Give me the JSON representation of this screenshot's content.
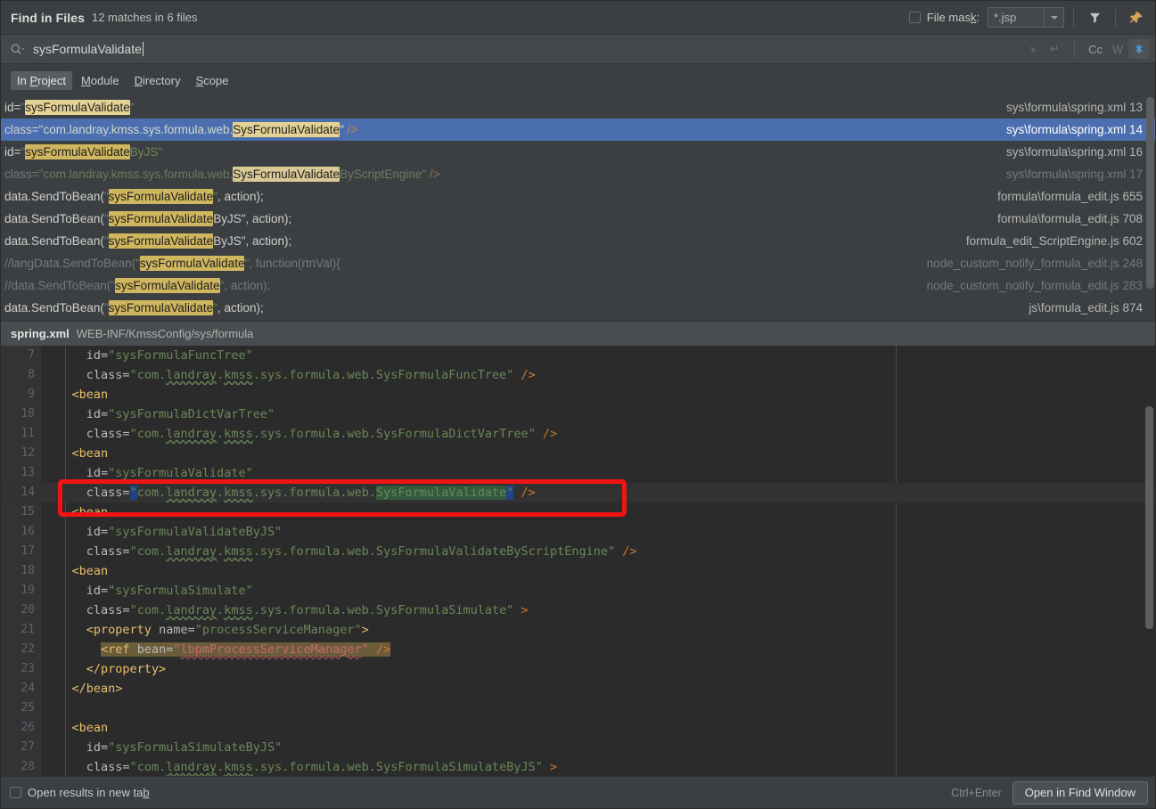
{
  "window": {
    "title": "Find in Files",
    "subtitle": "12 matches in 6 files"
  },
  "toolbar": {
    "file_mask_label_pre": "File mas",
    "file_mask_label_mnemonic": "k",
    "file_mask_label_post": ":",
    "file_mask_value": "*.jsp",
    "filter_icon": "filter-icon",
    "pin_icon": "pin-icon"
  },
  "search": {
    "value": "sysFormulaValidate",
    "icon": "search-icon",
    "clear_label": "×",
    "newline_label": "↵",
    "match_case_label": "Cc",
    "words_label": "W",
    "regex_label": "✻"
  },
  "scope": {
    "items": [
      {
        "pre": "In ",
        "mnemonic": "P",
        "post": "roject",
        "active": true
      },
      {
        "pre": "",
        "mnemonic": "M",
        "post": "odule",
        "active": false
      },
      {
        "pre": "",
        "mnemonic": "D",
        "post": "irectory",
        "active": false
      },
      {
        "pre": "",
        "mnemonic": "S",
        "post": "cope",
        "active": false
      }
    ]
  },
  "results": {
    "rows": [
      {
        "selected": false,
        "dim": false,
        "parts": [
          {
            "t": "id=",
            "c": "plain"
          },
          {
            "t": "\"",
            "c": "str"
          },
          {
            "t": "sysFormulaValidate",
            "c": "hl"
          },
          {
            "t": "\"",
            "c": "str"
          }
        ],
        "path": "sys\\formula\\spring.xml 13"
      },
      {
        "selected": true,
        "dim": false,
        "parts": [
          {
            "t": "class=",
            "c": "plain"
          },
          {
            "t": "\"com.landray.kmss.sys.formula.web.",
            "c": "str"
          },
          {
            "t": "SysFormulaValidate",
            "c": "hl"
          },
          {
            "t": "\"",
            "c": "str"
          },
          {
            "t": " ",
            "c": "plain"
          },
          {
            "t": "/>",
            "c": "punct"
          }
        ],
        "path": "sys\\formula\\spring.xml 14"
      },
      {
        "selected": false,
        "dim": false,
        "parts": [
          {
            "t": "id=",
            "c": "plain"
          },
          {
            "t": "\"",
            "c": "str"
          },
          {
            "t": "sysFormulaValidate",
            "c": "hl2"
          },
          {
            "t": "ByJS\"",
            "c": "str"
          }
        ],
        "path": "sys\\formula\\spring.xml 16"
      },
      {
        "selected": false,
        "dim": true,
        "parts": [
          {
            "t": "class=",
            "c": "plain"
          },
          {
            "t": "\"com.landray.kmss.sys.formula.web.",
            "c": "str"
          },
          {
            "t": "SysFormulaValidate",
            "c": "hl"
          },
          {
            "t": "ByScriptEngine\"",
            "c": "str"
          },
          {
            "t": " ",
            "c": "plain"
          },
          {
            "t": "/>",
            "c": "punct"
          }
        ],
        "path": "sys\\formula\\spring.xml 17"
      },
      {
        "selected": false,
        "dim": false,
        "parts": [
          {
            "t": "data.SendToBean(",
            "c": "plain"
          },
          {
            "t": "\"",
            "c": "str"
          },
          {
            "t": "sysFormulaValidate",
            "c": "hl2"
          },
          {
            "t": "\"",
            "c": "str"
          },
          {
            "t": ", action);",
            "c": "plain"
          }
        ],
        "path": "formula\\formula_edit.js 655"
      },
      {
        "selected": false,
        "dim": false,
        "parts": [
          {
            "t": "data.SendToBean(",
            "c": "plain"
          },
          {
            "t": "\"",
            "c": "str"
          },
          {
            "t": "sysFormulaValidate",
            "c": "hl2"
          },
          {
            "t": "ByJS\", action);",
            "c": "plain"
          }
        ],
        "path": "formula\\formula_edit.js 708"
      },
      {
        "selected": false,
        "dim": false,
        "parts": [
          {
            "t": "data.SendToBean(",
            "c": "plain"
          },
          {
            "t": "\"",
            "c": "str"
          },
          {
            "t": "sysFormulaValidate",
            "c": "hl2"
          },
          {
            "t": "ByJS\", action);",
            "c": "plain"
          }
        ],
        "path": "formula_edit_ScriptEngine.js 602"
      },
      {
        "selected": false,
        "dim": true,
        "parts": [
          {
            "t": "//langData.SendToBean(",
            "c": "plain"
          },
          {
            "t": "\"",
            "c": "str"
          },
          {
            "t": "sysFormulaValidate",
            "c": "hl2"
          },
          {
            "t": "\"",
            "c": "str"
          },
          {
            "t": ", function(rtnVal){",
            "c": "plain"
          }
        ],
        "path": "node_custom_notify_formula_edit.js 248"
      },
      {
        "selected": false,
        "dim": true,
        "parts": [
          {
            "t": "//data.SendToBean(",
            "c": "plain"
          },
          {
            "t": "\"",
            "c": "str"
          },
          {
            "t": "sysFormulaValidate",
            "c": "hl2"
          },
          {
            "t": "\"",
            "c": "str"
          },
          {
            "t": ", action);",
            "c": "plain"
          }
        ],
        "path": "node_custom_notify_formula_edit.js 283"
      },
      {
        "selected": false,
        "dim": false,
        "parts": [
          {
            "t": "data.SendToBean(",
            "c": "plain"
          },
          {
            "t": "\"",
            "c": "str"
          },
          {
            "t": "sysFormulaValidate",
            "c": "hl2"
          },
          {
            "t": "\"",
            "c": "str"
          },
          {
            "t": ", action);",
            "c": "plain"
          }
        ],
        "path": "js\\formula_edit.js 874"
      }
    ]
  },
  "file_header": {
    "name": "spring.xml",
    "path": "WEB-INF/KmssConfig/sys/formula"
  },
  "code": {
    "lines": [
      {
        "n": "7",
        "indent": 6,
        "cur": false,
        "parts": [
          {
            "t": "id=",
            "c": "attrname"
          },
          {
            "t": "\"sysFormulaFuncTree\"",
            "c": "str"
          }
        ]
      },
      {
        "n": "8",
        "indent": 6,
        "cur": false,
        "parts": [
          {
            "t": "class=",
            "c": "attrname"
          },
          {
            "t": "\"com.",
            "c": "str"
          },
          {
            "t": "landray",
            "c": "str-wavy"
          },
          {
            "t": ".",
            "c": "str"
          },
          {
            "t": "kmss",
            "c": "str-wavy"
          },
          {
            "t": ".sys.formula.web.SysFormulaFuncTree\"",
            "c": "str"
          },
          {
            "t": " ",
            "c": "plain"
          },
          {
            "t": "/>",
            "c": "punct"
          }
        ]
      },
      {
        "n": "9",
        "indent": 4,
        "cur": false,
        "parts": [
          {
            "t": "<bean",
            "c": "tag"
          }
        ]
      },
      {
        "n": "10",
        "indent": 6,
        "cur": false,
        "parts": [
          {
            "t": "id=",
            "c": "attrname"
          },
          {
            "t": "\"sysFormulaDictVarTree\"",
            "c": "str"
          }
        ]
      },
      {
        "n": "11",
        "indent": 6,
        "cur": false,
        "parts": [
          {
            "t": "class=",
            "c": "attrname"
          },
          {
            "t": "\"com.",
            "c": "str"
          },
          {
            "t": "landray",
            "c": "str-wavy"
          },
          {
            "t": ".",
            "c": "str"
          },
          {
            "t": "kmss",
            "c": "str-wavy"
          },
          {
            "t": ".sys.formula.web.SysFormulaDictVarTree\"",
            "c": "str"
          },
          {
            "t": " ",
            "c": "plain"
          },
          {
            "t": "/>",
            "c": "punct"
          }
        ]
      },
      {
        "n": "12",
        "indent": 4,
        "cur": false,
        "parts": [
          {
            "t": "<bean",
            "c": "tag"
          }
        ]
      },
      {
        "n": "13",
        "indent": 6,
        "cur": false,
        "parts": [
          {
            "t": "id=",
            "c": "attrname"
          },
          {
            "t": "\"sysFormulaValidate\"",
            "c": "str"
          }
        ]
      },
      {
        "n": "14",
        "indent": 6,
        "cur": true,
        "parts": [
          {
            "t": "class=",
            "c": "attrname"
          },
          {
            "t": "\"",
            "c": "str-sel"
          },
          {
            "t": "com.",
            "c": "str"
          },
          {
            "t": "landray",
            "c": "str-wavy"
          },
          {
            "t": ".",
            "c": "str"
          },
          {
            "t": "kmss",
            "c": "str-wavy"
          },
          {
            "t": ".sys.formula.web.",
            "c": "str"
          },
          {
            "t": "SysFormulaValidate",
            "c": "str-match"
          },
          {
            "t": "\"",
            "c": "str-sel"
          },
          {
            "t": " ",
            "c": "plain"
          },
          {
            "t": "/>",
            "c": "punct"
          }
        ]
      },
      {
        "n": "15",
        "indent": 4,
        "cur": false,
        "parts": [
          {
            "t": "<bean",
            "c": "tag"
          }
        ]
      },
      {
        "n": "16",
        "indent": 6,
        "cur": false,
        "parts": [
          {
            "t": "id=",
            "c": "attrname"
          },
          {
            "t": "\"sysFormulaValidateByJS\"",
            "c": "str"
          }
        ]
      },
      {
        "n": "17",
        "indent": 6,
        "cur": false,
        "parts": [
          {
            "t": "class=",
            "c": "attrname"
          },
          {
            "t": "\"com.",
            "c": "str"
          },
          {
            "t": "landray",
            "c": "str-wavy"
          },
          {
            "t": ".",
            "c": "str"
          },
          {
            "t": "kmss",
            "c": "str-wavy"
          },
          {
            "t": ".sys.formula.web.SysFormulaValidateByScriptEngine\"",
            "c": "str"
          },
          {
            "t": " ",
            "c": "plain"
          },
          {
            "t": "/>",
            "c": "punct"
          }
        ]
      },
      {
        "n": "18",
        "indent": 4,
        "cur": false,
        "parts": [
          {
            "t": "<bean",
            "c": "tag"
          }
        ]
      },
      {
        "n": "19",
        "indent": 6,
        "cur": false,
        "parts": [
          {
            "t": "id=",
            "c": "attrname"
          },
          {
            "t": "\"sysFormulaSimulate\"",
            "c": "str"
          }
        ]
      },
      {
        "n": "20",
        "indent": 6,
        "cur": false,
        "parts": [
          {
            "t": "class=",
            "c": "attrname"
          },
          {
            "t": "\"com.",
            "c": "str"
          },
          {
            "t": "landray",
            "c": "str-wavy"
          },
          {
            "t": ".",
            "c": "str"
          },
          {
            "t": "kmss",
            "c": "str-wavy"
          },
          {
            "t": ".sys.formula.web.SysFormulaSimulate\"",
            "c": "str"
          },
          {
            "t": " ",
            "c": "plain"
          },
          {
            "t": ">",
            "c": "punct"
          }
        ]
      },
      {
        "n": "21",
        "indent": 6,
        "cur": false,
        "parts": [
          {
            "t": "<property",
            "c": "tag"
          },
          {
            "t": " ",
            "c": "plain"
          },
          {
            "t": "name=",
            "c": "attrname"
          },
          {
            "t": "\"processServiceManager\"",
            "c": "str"
          },
          {
            "t": ">",
            "c": "tag"
          }
        ]
      },
      {
        "n": "22",
        "indent": 8,
        "cur": false,
        "refhl": true,
        "parts": [
          {
            "t": "<ref",
            "c": "tag"
          },
          {
            "t": " ",
            "c": "plain"
          },
          {
            "t": "bean=",
            "c": "attrname"
          },
          {
            "t": "\"",
            "c": "red"
          },
          {
            "t": "lbpmProcessServiceManager",
            "c": "red-wavy"
          },
          {
            "t": "\"",
            "c": "red"
          },
          {
            "t": " ",
            "c": "plain"
          },
          {
            "t": "/>",
            "c": "punct"
          }
        ]
      },
      {
        "n": "23",
        "indent": 6,
        "cur": false,
        "parts": [
          {
            "t": "</property>",
            "c": "tag"
          }
        ]
      },
      {
        "n": "24",
        "indent": 4,
        "cur": false,
        "parts": [
          {
            "t": "</bean>",
            "c": "tag"
          }
        ]
      },
      {
        "n": "25",
        "indent": 0,
        "cur": false,
        "parts": []
      },
      {
        "n": "26",
        "indent": 4,
        "cur": false,
        "parts": [
          {
            "t": "<bean",
            "c": "tag"
          }
        ]
      },
      {
        "n": "27",
        "indent": 6,
        "cur": false,
        "parts": [
          {
            "t": "id=",
            "c": "attrname"
          },
          {
            "t": "\"sysFormulaSimulateByJS\"",
            "c": "str"
          }
        ]
      },
      {
        "n": "28",
        "indent": 6,
        "cur": false,
        "parts": [
          {
            "t": "class=",
            "c": "attrname"
          },
          {
            "t": "\"com.",
            "c": "str"
          },
          {
            "t": "landray",
            "c": "str-wavy"
          },
          {
            "t": ".",
            "c": "str"
          },
          {
            "t": "kmss",
            "c": "str-wavy"
          },
          {
            "t": ".sys.formula.web.SysFormulaSimulateByJS\"",
            "c": "str"
          },
          {
            "t": " ",
            "c": "plain"
          },
          {
            "t": ">",
            "c": "punct"
          }
        ]
      }
    ]
  },
  "bottom": {
    "checkbox_pre": "Open results in new ta",
    "checkbox_mnemonic": "b",
    "shortcut": "Ctrl+Enter",
    "primary_button": "Open in Find Window"
  },
  "colors": {
    "selection_blue": "#4b6eaf",
    "highlight_yellow": "#e4d294",
    "annotation_red": "#f21414",
    "editor_bg": "#2b2b2b",
    "panel_bg": "#3c3f41"
  }
}
